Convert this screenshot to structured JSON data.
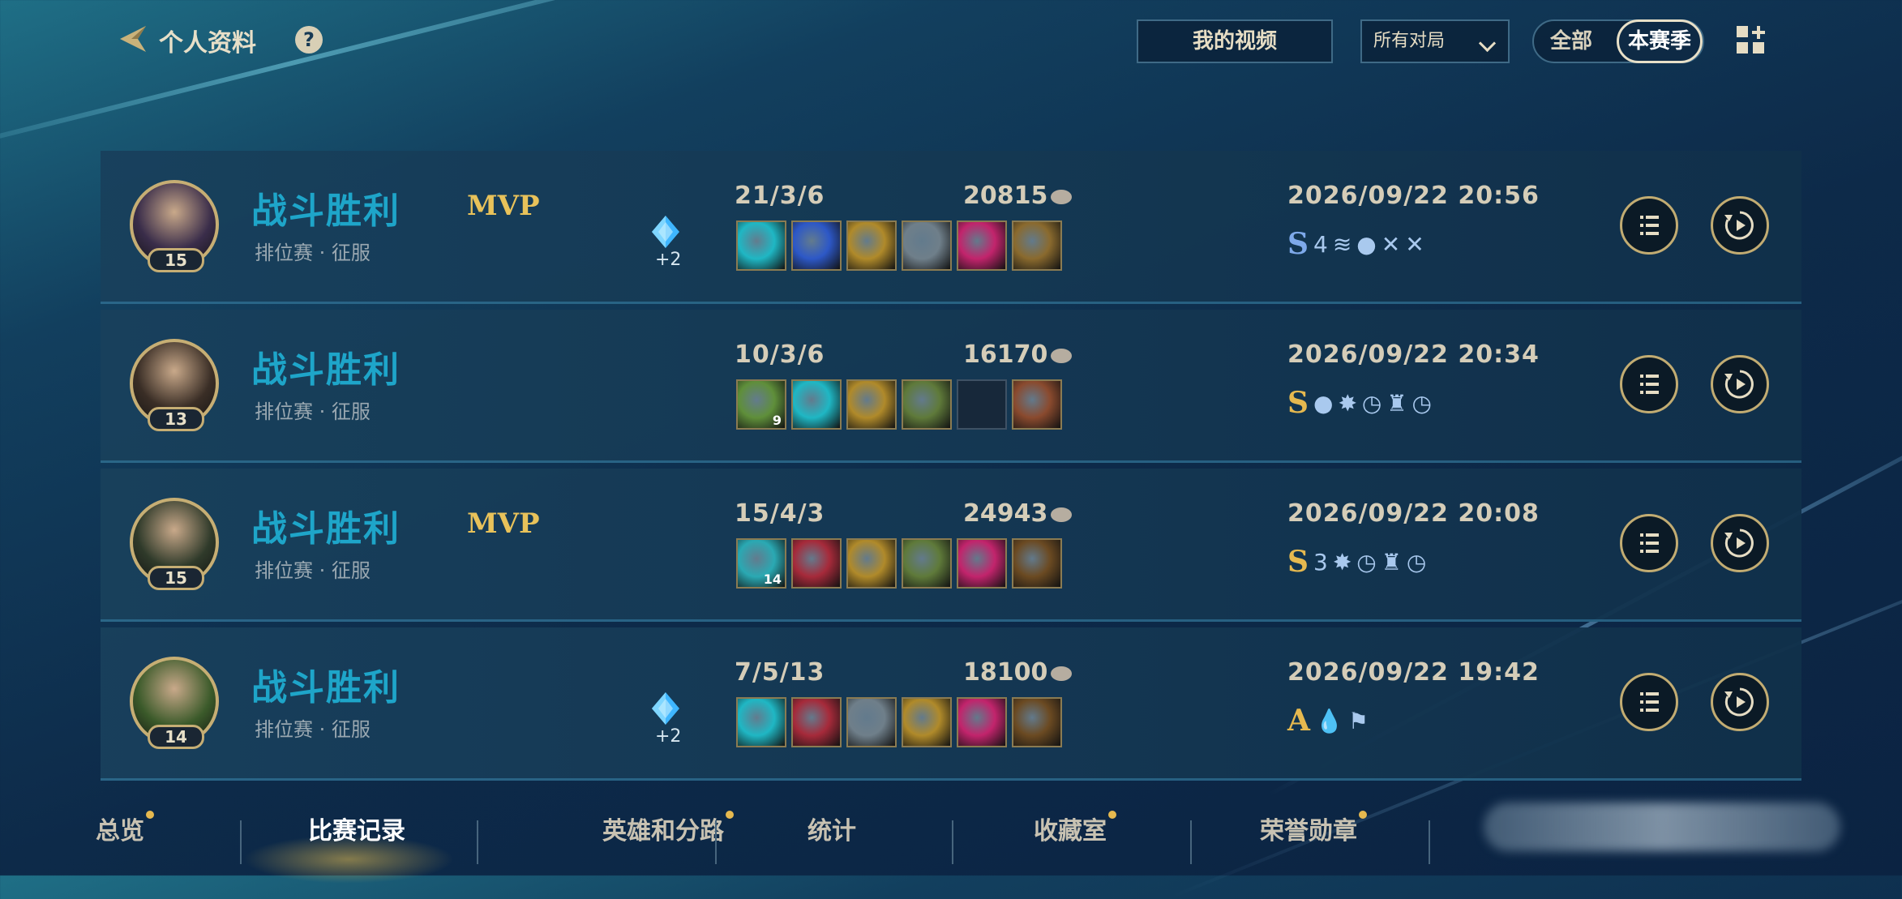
{
  "header": {
    "title": "个人资料",
    "help": "?",
    "my_videos": "我的视频",
    "filter_selected": "所有对局",
    "toggle_all": "全部",
    "toggle_season": "本赛季"
  },
  "matches": [
    {
      "result": "战斗胜利",
      "mode": "排位赛 · 征服",
      "level": "15",
      "mvp": "MVP",
      "gem_bonus": "+2",
      "kda": "21/3/6",
      "gold": "20815",
      "datetime": "2026/09/22 20:56",
      "grade": "S",
      "grade_color": "#7ea9ea",
      "badges": [
        "4",
        "≋",
        "●",
        "✕",
        "✕"
      ],
      "items": [
        {
          "color": "#1fb7c4",
          "stack": ""
        },
        {
          "color": "#2d58c7",
          "stack": ""
        },
        {
          "color": "#b08a2a",
          "stack": ""
        },
        {
          "color": "#6f7f8a",
          "stack": ""
        },
        {
          "color": "#c2246c",
          "stack": ""
        },
        {
          "color": "#8a6a2e",
          "stack": ""
        }
      ]
    },
    {
      "result": "战斗胜利",
      "mode": "排位赛 · 征服",
      "level": "13",
      "mvp": "",
      "gem_bonus": "",
      "kda": "10/3/6",
      "gold": "16170",
      "datetime": "2026/09/22 20:34",
      "grade": "S",
      "grade_color": "#e6b94f",
      "badges": [
        "●",
        "✸",
        "◷",
        "♜",
        "◷"
      ],
      "items": [
        {
          "color": "#5f8f3a",
          "stack": "9"
        },
        {
          "color": "#1fb7c4",
          "stack": ""
        },
        {
          "color": "#b08a2a",
          "stack": ""
        },
        {
          "color": "#5f7a3a",
          "stack": ""
        },
        {
          "color": "",
          "stack": ""
        },
        {
          "color": "#8a4a2e",
          "stack": ""
        }
      ]
    },
    {
      "result": "战斗胜利",
      "mode": "排位赛 · 征服",
      "level": "15",
      "mvp": "MVP",
      "gem_bonus": "",
      "kda": "15/4/3",
      "gold": "24943",
      "datetime": "2026/09/22 20:08",
      "grade": "S",
      "grade_color": "#e6b94f",
      "badges": [
        "3",
        "✸",
        "◷",
        "♜",
        "◷"
      ],
      "items": [
        {
          "color": "#2aa9b3",
          "stack": "14"
        },
        {
          "color": "#a62a3a",
          "stack": ""
        },
        {
          "color": "#b08a2a",
          "stack": ""
        },
        {
          "color": "#5f7a3a",
          "stack": ""
        },
        {
          "color": "#c2246c",
          "stack": ""
        },
        {
          "color": "#6b4a22",
          "stack": ""
        }
      ]
    },
    {
      "result": "战斗胜利",
      "mode": "排位赛 · 征服",
      "level": "14",
      "mvp": "",
      "gem_bonus": "+2",
      "kda": "7/5/13",
      "gold": "18100",
      "datetime": "2026/09/22 19:42",
      "grade": "A",
      "grade_color": "#e6b94f",
      "badges": [
        "💧",
        "⚑"
      ],
      "items": [
        {
          "color": "#1fb7c4",
          "stack": ""
        },
        {
          "color": "#a62a3a",
          "stack": ""
        },
        {
          "color": "#6f7f8a",
          "stack": ""
        },
        {
          "color": "#b08a2a",
          "stack": ""
        },
        {
          "color": "#c2246c",
          "stack": ""
        },
        {
          "color": "#6b4a22",
          "stack": ""
        }
      ]
    }
  ],
  "tabs": [
    {
      "label": "总览",
      "dot": true,
      "active": false
    },
    {
      "label": "比赛记录",
      "dot": false,
      "active": true
    },
    {
      "label": "英雄和分路",
      "dot": true,
      "active": false
    },
    {
      "label": "统计",
      "dot": false,
      "active": false
    },
    {
      "label": "收藏室",
      "dot": true,
      "active": false
    },
    {
      "label": "荣誉勋章",
      "dot": true,
      "active": false
    }
  ],
  "colors": {
    "accent_gold": "#c6ae74",
    "result_blue": "#1ea5c9",
    "mvp_gold": "#e8c25a"
  }
}
